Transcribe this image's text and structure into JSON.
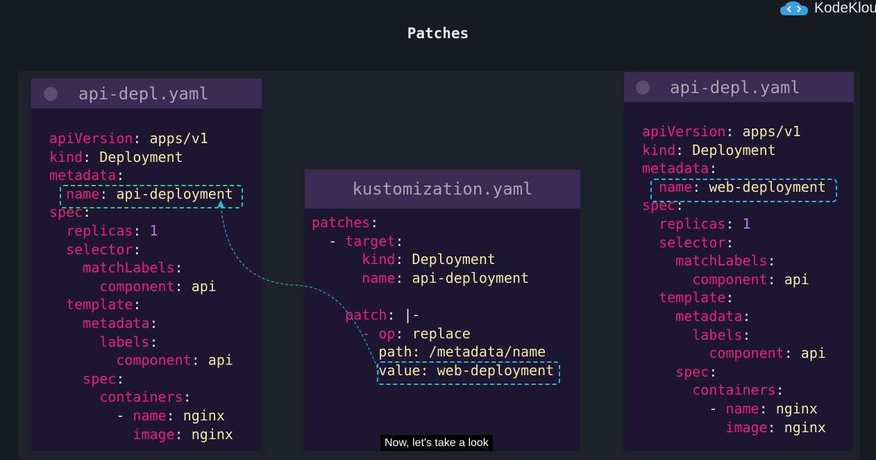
{
  "brand": {
    "name": "KodeKlou"
  },
  "slide_title": "Patches",
  "left_panel": {
    "filename": "api-depl.yaml",
    "lines": [
      [
        [
          "k",
          "apiVersion"
        ],
        [
          "p",
          ": "
        ],
        [
          "v",
          "apps/v1"
        ]
      ],
      [
        [
          "k",
          "kind"
        ],
        [
          "p",
          ": "
        ],
        [
          "v",
          "Deployment"
        ]
      ],
      [
        [
          "k",
          "metadata"
        ],
        [
          "p",
          ":"
        ]
      ],
      [
        [
          "p",
          "  "
        ],
        [
          "k",
          "name"
        ],
        [
          "p",
          ": "
        ],
        [
          "v",
          "api-deployment"
        ]
      ],
      [
        [
          "k",
          "spec"
        ],
        [
          "p",
          ":"
        ]
      ],
      [
        [
          "p",
          "  "
        ],
        [
          "k",
          "replicas"
        ],
        [
          "p",
          ": "
        ],
        [
          "n",
          "1"
        ]
      ],
      [
        [
          "p",
          "  "
        ],
        [
          "k",
          "selector"
        ],
        [
          "p",
          ":"
        ]
      ],
      [
        [
          "p",
          "    "
        ],
        [
          "k",
          "matchLabels"
        ],
        [
          "p",
          ":"
        ]
      ],
      [
        [
          "p",
          "      "
        ],
        [
          "k",
          "component"
        ],
        [
          "p",
          ": "
        ],
        [
          "v",
          "api"
        ]
      ],
      [
        [
          "p",
          "  "
        ],
        [
          "k",
          "template"
        ],
        [
          "p",
          ":"
        ]
      ],
      [
        [
          "p",
          "    "
        ],
        [
          "k",
          "metadata"
        ],
        [
          "p",
          ":"
        ]
      ],
      [
        [
          "p",
          "      "
        ],
        [
          "k",
          "labels"
        ],
        [
          "p",
          ":"
        ]
      ],
      [
        [
          "p",
          "        "
        ],
        [
          "k",
          "component"
        ],
        [
          "p",
          ": "
        ],
        [
          "v",
          "api"
        ]
      ],
      [
        [
          "p",
          "    "
        ],
        [
          "k",
          "spec"
        ],
        [
          "p",
          ":"
        ]
      ],
      [
        [
          "p",
          "      "
        ],
        [
          "k",
          "containers"
        ],
        [
          "p",
          ":"
        ]
      ],
      [
        [
          "p",
          "        - "
        ],
        [
          "k",
          "name"
        ],
        [
          "p",
          ": "
        ],
        [
          "v",
          "nginx"
        ]
      ],
      [
        [
          "p",
          "          "
        ],
        [
          "k",
          "image"
        ],
        [
          "p",
          ": "
        ],
        [
          "v",
          "nginx"
        ]
      ]
    ]
  },
  "middle_panel": {
    "filename": "kustomization.yaml",
    "lines": [
      [
        [
          "k",
          "patches"
        ],
        [
          "p",
          ":"
        ]
      ],
      [
        [
          "p",
          "  - "
        ],
        [
          "k",
          "target"
        ],
        [
          "p",
          ":"
        ]
      ],
      [
        [
          "p",
          "      "
        ],
        [
          "k",
          "kind"
        ],
        [
          "p",
          ": "
        ],
        [
          "v",
          "Deployment"
        ]
      ],
      [
        [
          "p",
          "      "
        ],
        [
          "k",
          "name"
        ],
        [
          "p",
          ": "
        ],
        [
          "v",
          "api-deployment"
        ]
      ],
      [
        [
          "p",
          ""
        ]
      ],
      [
        [
          "p",
          "    "
        ],
        [
          "k",
          "patch"
        ],
        [
          "p",
          ": |-"
        ]
      ],
      [
        [
          "p",
          "      "
        ],
        [
          "k",
          "- op"
        ],
        [
          "p",
          ": "
        ],
        [
          "v",
          "replace"
        ]
      ],
      [
        [
          "p",
          "        "
        ],
        [
          "v",
          "path: /metadata/name"
        ]
      ],
      [
        [
          "p",
          "        "
        ],
        [
          "v",
          "value: web-deployment"
        ]
      ]
    ]
  },
  "right_panel": {
    "filename": "api-depl.yaml",
    "lines": [
      [
        [
          "k",
          "apiVersion"
        ],
        [
          "p",
          ": "
        ],
        [
          "v",
          "apps/v1"
        ]
      ],
      [
        [
          "k",
          "kind"
        ],
        [
          "p",
          ": "
        ],
        [
          "v",
          "Deployment"
        ]
      ],
      [
        [
          "k",
          "metadata"
        ],
        [
          "p",
          ":"
        ]
      ],
      [
        [
          "p",
          "  "
        ],
        [
          "k",
          "name"
        ],
        [
          "p",
          ": "
        ],
        [
          "v",
          "web-deployment"
        ]
      ],
      [
        [
          "k",
          "spec"
        ],
        [
          "p",
          ":"
        ]
      ],
      [
        [
          "p",
          "  "
        ],
        [
          "k",
          "replicas"
        ],
        [
          "p",
          ": "
        ],
        [
          "n",
          "1"
        ]
      ],
      [
        [
          "p",
          "  "
        ],
        [
          "k",
          "selector"
        ],
        [
          "p",
          ":"
        ]
      ],
      [
        [
          "p",
          "    "
        ],
        [
          "k",
          "matchLabels"
        ],
        [
          "p",
          ":"
        ]
      ],
      [
        [
          "p",
          "      "
        ],
        [
          "k",
          "component"
        ],
        [
          "p",
          ": "
        ],
        [
          "v",
          "api"
        ]
      ],
      [
        [
          "p",
          "  "
        ],
        [
          "k",
          "template"
        ],
        [
          "p",
          ":"
        ]
      ],
      [
        [
          "p",
          "    "
        ],
        [
          "k",
          "metadata"
        ],
        [
          "p",
          ":"
        ]
      ],
      [
        [
          "p",
          "      "
        ],
        [
          "k",
          "labels"
        ],
        [
          "p",
          ":"
        ]
      ],
      [
        [
          "p",
          "        "
        ],
        [
          "k",
          "component"
        ],
        [
          "p",
          ": "
        ],
        [
          "v",
          "api"
        ]
      ],
      [
        [
          "p",
          "    "
        ],
        [
          "k",
          "spec"
        ],
        [
          "p",
          ":"
        ]
      ],
      [
        [
          "p",
          "      "
        ],
        [
          "k",
          "containers"
        ],
        [
          "p",
          ":"
        ]
      ],
      [
        [
          "p",
          "        - "
        ],
        [
          "k",
          "name"
        ],
        [
          "p",
          ": "
        ],
        [
          "v",
          "nginx"
        ]
      ],
      [
        [
          "p",
          "          "
        ],
        [
          "k",
          "image"
        ],
        [
          "p",
          ": "
        ],
        [
          "v",
          "nginx"
        ]
      ]
    ]
  },
  "caption": "Now, let's take a look",
  "colors": {
    "key": "#e8207a",
    "value": "#f0e9a4",
    "number": "#b57cf5",
    "highlight_original": "#36c78a",
    "highlight_patch": "#2fb2dc"
  }
}
